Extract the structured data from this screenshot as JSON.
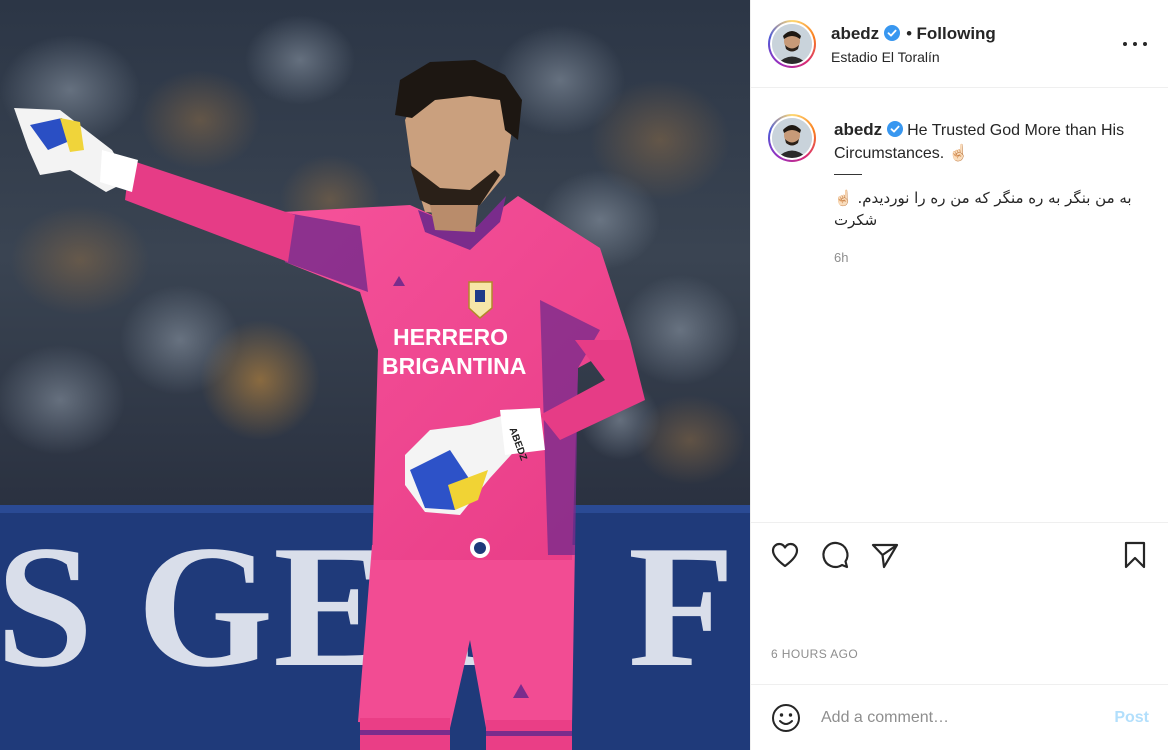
{
  "post": {
    "username": "abedz",
    "verified": true,
    "follow_separator": "•",
    "follow_state": "Following",
    "location": "Estadio El Toralín",
    "photo": {
      "sponsor_line_1": "HERRERO",
      "sponsor_line_2": "BRIGANTINA",
      "banner_text": "S GEY",
      "banner_text_right": "F",
      "glove_text": "ABEDZ"
    }
  },
  "caption": {
    "username": "abedz",
    "text_en": "He Trusted God More than His Circumstances. ☝🏻",
    "divider": "——",
    "text_fa_line_1": "به من بنگر به ره منگر که من ره را نوردیدم. ☝🏻",
    "text_fa_line_2": "شکرت",
    "relative_time": "6h"
  },
  "actions": {
    "like": "heart-icon",
    "comment": "comment-icon",
    "share": "send-icon",
    "save": "bookmark-icon"
  },
  "timestamp": "6 HOURS AGO",
  "comment_box": {
    "placeholder": "Add a comment…",
    "post_label": "Post"
  },
  "colors": {
    "kit_pink": "#f2438f",
    "sleeve_purple": "#7a2c8c",
    "link_disabled": "#b2dffc",
    "verified_blue": "#3897f0"
  }
}
